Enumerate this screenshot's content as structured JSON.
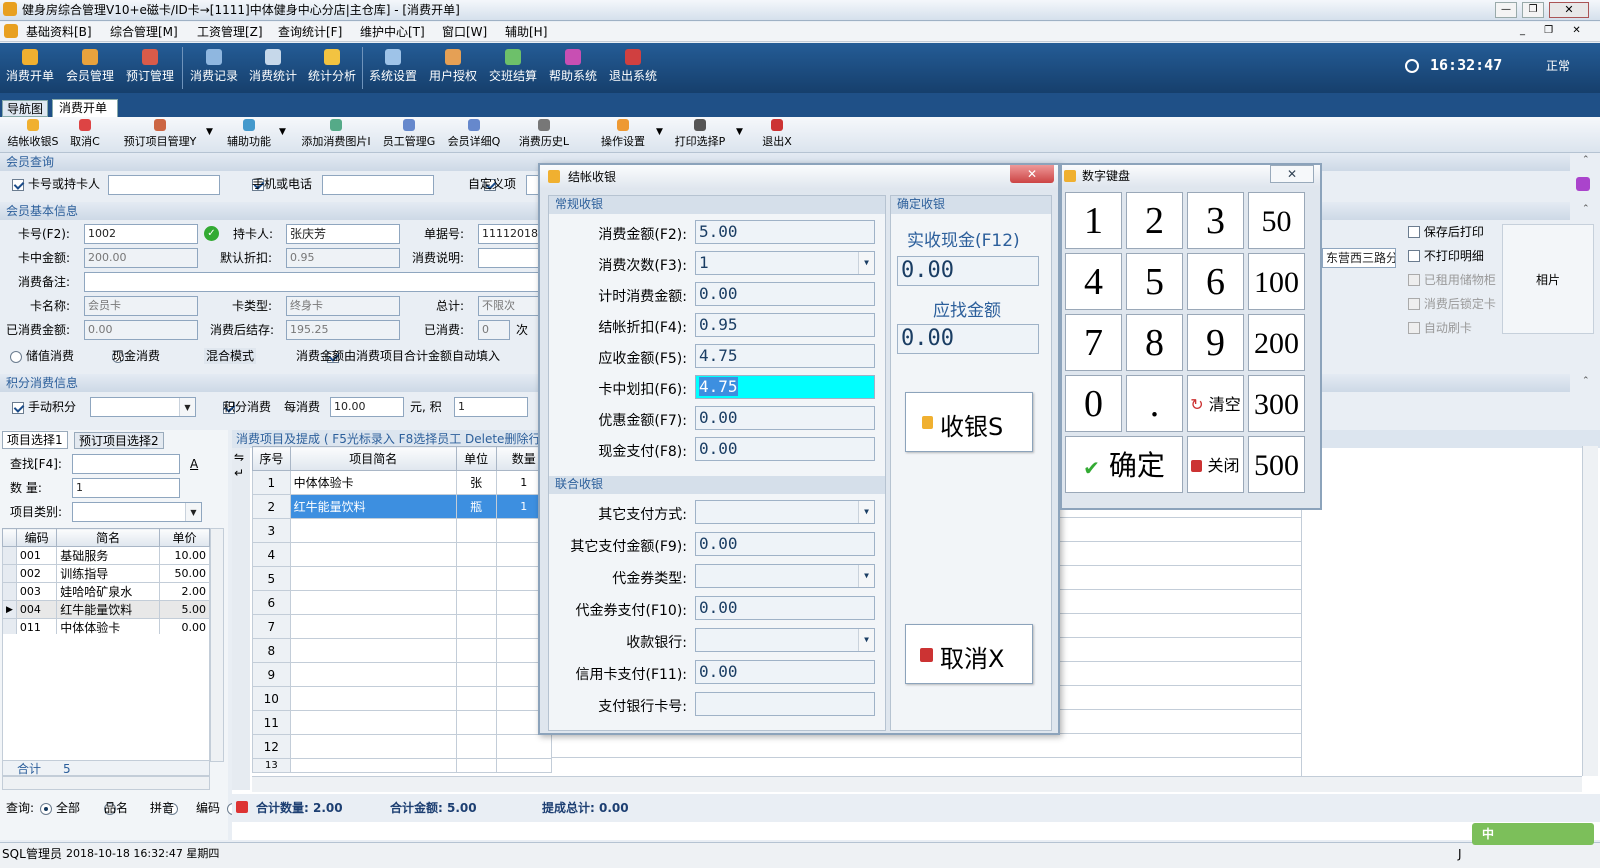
{
  "window": {
    "title": "健身房综合管理V10+e磁卡/ID卡→[1111]中体健身中心分店|主仓库] - [消费开单]"
  },
  "menu": [
    "基础资料[B]",
    "综合管理[M]",
    "工资管理[Z]",
    "查询统计[F]",
    "维护中心[T]",
    "窗口[W]",
    "辅助[H]"
  ],
  "toolbar": {
    "items": [
      "消费开单",
      "会员管理",
      "预订管理",
      "消费记录",
      "消费统计",
      "统计分析",
      "系统设置",
      "用户授权",
      "交班结算",
      "帮助系统",
      "退出系统"
    ],
    "clock": "16:32:47",
    "mode": "正常"
  },
  "tabs": [
    "导航图",
    "消费开单"
  ],
  "actionbar": [
    "结帐收银S",
    "取消C",
    "预订项目管理Y",
    "辅助功能",
    "添加消费图片I",
    "员工管理G",
    "会员详细Q",
    "消费历史L",
    "操作设置",
    "打印选择P",
    "退出X"
  ],
  "member_query": {
    "header": "会员查询",
    "card_or_holder": "卡号或持卡人",
    "phone": "手机或电话",
    "custom": "自定义项"
  },
  "member_info": {
    "header": "会员基本信息",
    "fields": {
      "card_no_label": "卡号(F2):",
      "card_no": "1002",
      "holder_label": "持卡人:",
      "holder": "张庆芳",
      "bill_no_label": "单据号:",
      "bill_no": "1111201810",
      "card_amount_label": "卡中金额:",
      "card_amount": "200.00",
      "default_discount_label": "默认折扣:",
      "default_discount": "0.95",
      "consume_note_label": "消费说明:",
      "remark_label": "消费备注:",
      "card_name_label": "卡名称:",
      "card_name": "会员卡",
      "card_type_label": "卡类型:",
      "card_type": "终身卡",
      "total_label": "总计:",
      "total": "不限次",
      "spent_amount_label": "已消费金额:",
      "spent_amount": "0.00",
      "remaining_label": "消费后结存:",
      "remaining": "195.25",
      "spent_label": "已消费:",
      "spent": "0",
      "spent_unit": "次"
    },
    "options": {
      "stored_value": "储值消费",
      "cash": "现金消费",
      "mixed": "混合模式",
      "auto_fill": "消费金额由消费项目合计金额自动填入"
    },
    "address": "东营西三路分",
    "photo": "相片",
    "checks": [
      "保存后打印",
      "不打印明细",
      "已租用储物柜",
      "消费后锁定卡",
      "自动刷卡"
    ]
  },
  "points": {
    "header": "积分消费信息",
    "manual": "手动积分",
    "points_consume": "积分消费",
    "per_label": "每消费",
    "per_value": "10.00",
    "unit": "元, 积",
    "value2": "1"
  },
  "left_panel": {
    "tabs": [
      "项目选择1",
      "预订项目选择2"
    ],
    "search_label": "查找[F4]:",
    "search_link": "A",
    "qty_label": "数   量:",
    "qty": "1",
    "category_label": "项目类别:",
    "headers": [
      "编码",
      "简名",
      "单价"
    ],
    "rows": [
      {
        "code": "001",
        "name": "基础服务",
        "price": "10.00"
      },
      {
        "code": "002",
        "name": "训练指导",
        "price": "50.00"
      },
      {
        "code": "003",
        "name": "娃哈哈矿泉水",
        "price": "2.00"
      },
      {
        "code": "004",
        "name": "红牛能量饮料",
        "price": "5.00"
      },
      {
        "code": "011",
        "name": "中体体验卡",
        "price": "0.00"
      }
    ],
    "total_label": "合计",
    "total": "5",
    "query_label": "查询:",
    "query_opts": [
      "全部",
      "品名",
      "拼音",
      "编码"
    ]
  },
  "main_grid": {
    "hint": "消费项目及提成 ( F5光标录入 F8选择员工 Delete删除行",
    "headers": [
      "序号",
      "项目简名",
      "单位",
      "数量"
    ],
    "rows": [
      {
        "no": "1",
        "name": "中体体验卡",
        "unit": "张",
        "qty": "1"
      },
      {
        "no": "2",
        "name": "红牛能量饮料",
        "unit": "瓶",
        "qty": "1"
      },
      {
        "no": "3"
      },
      {
        "no": "4"
      },
      {
        "no": "5"
      },
      {
        "no": "6"
      },
      {
        "no": "7"
      },
      {
        "no": "8"
      },
      {
        "no": "9"
      },
      {
        "no": "10"
      },
      {
        "no": "11"
      },
      {
        "no": "12"
      },
      {
        "no": "13"
      }
    ],
    "summary": {
      "count": "合计数量: 2.00",
      "amount": "合计金额: 5.00",
      "commission": "提成总计: 0.00"
    }
  },
  "status": {
    "db": "SQL",
    "user": "管理员",
    "datetime": "2018-10-18 16:32:47 星期四",
    "right": "J",
    "ime": "中"
  },
  "checkout": {
    "title": "结帐收银",
    "group1": "常规收银",
    "group2": "联合收银",
    "group3": "确定收银",
    "fields": [
      {
        "label": "消费金额(F2):",
        "value": "5.00"
      },
      {
        "label": "消费次数(F3):",
        "value": "1"
      },
      {
        "label": "计时消费金额:",
        "value": "0.00"
      },
      {
        "label": "结帐折扣(F4):",
        "value": "0.95"
      },
      {
        "label": "应收金额(F5):",
        "value": "4.75"
      },
      {
        "label": "卡中划扣(F6):",
        "value": "4.75"
      },
      {
        "label": "优惠金额(F7):",
        "value": "0.00"
      },
      {
        "label": "现金支付(F8):",
        "value": "0.00"
      }
    ],
    "joint": [
      {
        "label": "其它支付方式:",
        "value": ""
      },
      {
        "label": "其它支付金额(F9):",
        "value": "0.00"
      },
      {
        "label": "代金券类型:",
        "value": ""
      },
      {
        "label": "代金券支付(F10):",
        "value": "0.00"
      },
      {
        "label": "收款银行:",
        "value": ""
      },
      {
        "label": "信用卡支付(F11):",
        "value": "0.00"
      },
      {
        "label": "支付银行卡号:",
        "value": ""
      }
    ],
    "cash_label": "实收现金(F12)",
    "cash_value": "0.00",
    "change_label": "应找金额",
    "change_value": "0.00",
    "pay_button": "收银S",
    "cancel_button": "取消X"
  },
  "keypad": {
    "title": "数字键盘",
    "keys": [
      "1",
      "2",
      "3",
      "50",
      "4",
      "5",
      "6",
      "100",
      "7",
      "8",
      "9",
      "200",
      "0",
      ".",
      "清空",
      "300",
      "确定",
      "关闭",
      "500"
    ]
  },
  "colors": {
    "title_bar": "#0e3d6e",
    "toolbar": "#1a4c80",
    "highlight": "#3d8fe0",
    "cyan": "#00ffff"
  }
}
